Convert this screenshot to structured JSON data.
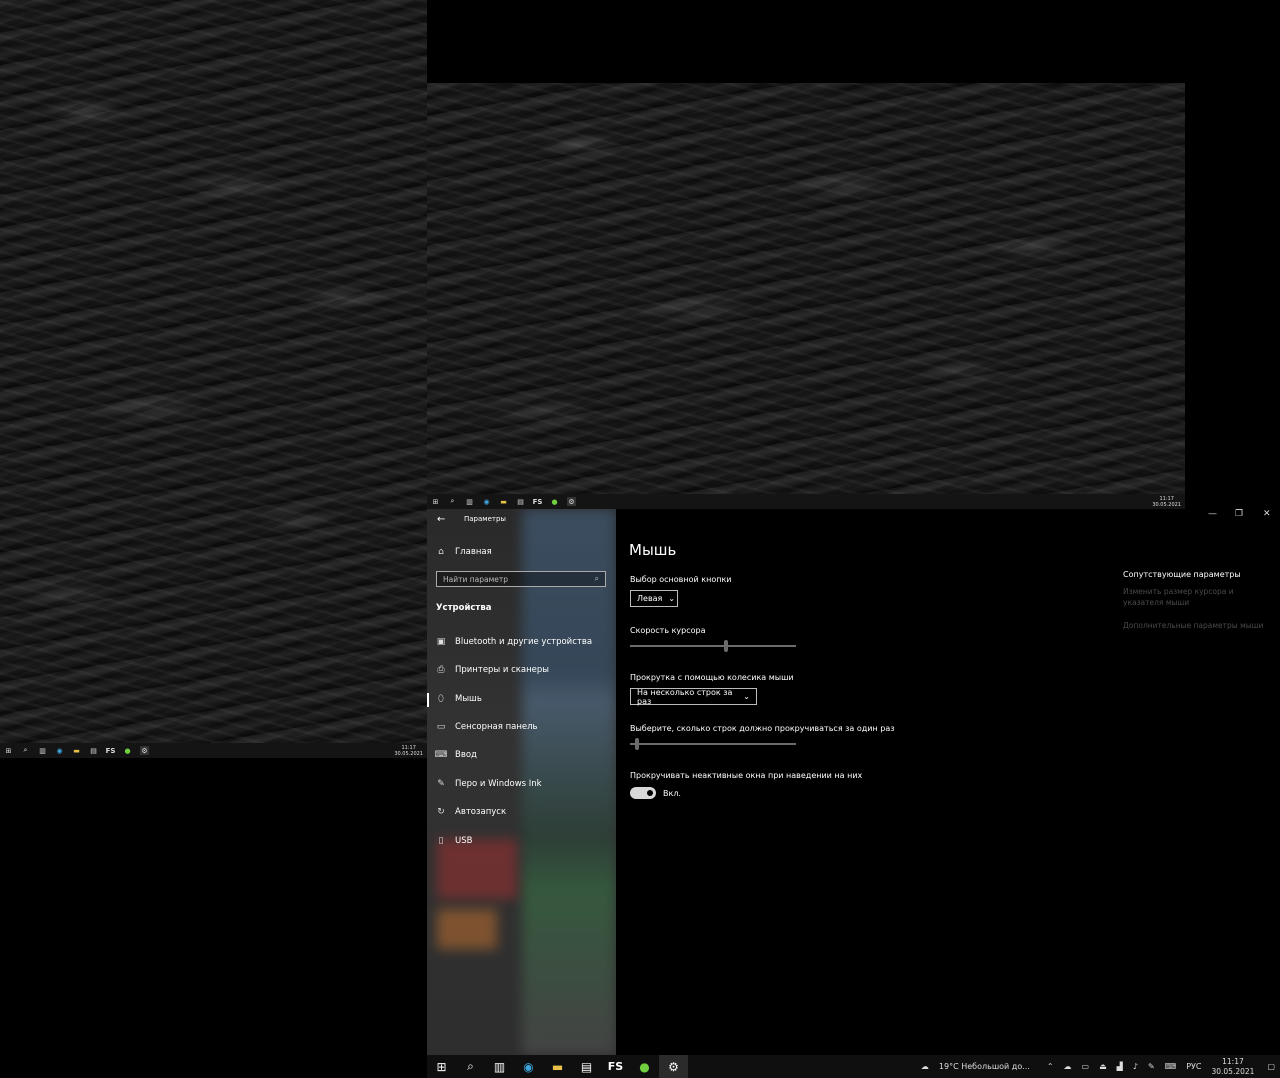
{
  "monitor_left": {
    "taskbar": {
      "time": "11:17",
      "date": "30.05.2021"
    }
  },
  "monitor_top": {
    "taskbar": {
      "time": "11:17",
      "date": "30.05.2021"
    }
  },
  "settings": {
    "window_title": "Параметры",
    "home_label": "Главная",
    "search_placeholder": "Найти параметр",
    "section_title": "Устройства",
    "nav_items": [
      {
        "label": "Bluetooth и другие устройства",
        "icon": "bluetooth-device-icon"
      },
      {
        "label": "Принтеры и сканеры",
        "icon": "printer-icon"
      },
      {
        "label": "Мышь",
        "icon": "mouse-icon"
      },
      {
        "label": "Сенсорная панель",
        "icon": "touchpad-icon"
      },
      {
        "label": "Ввод",
        "icon": "keyboard-icon"
      },
      {
        "label": "Перо и Windows Ink",
        "icon": "pen-icon"
      },
      {
        "label": "Автозапуск",
        "icon": "autoplay-icon"
      },
      {
        "label": "USB",
        "icon": "usb-icon"
      }
    ],
    "page_title": "Мышь",
    "primary_button_label": "Выбор основной кнопки",
    "primary_button_value": "Левая",
    "cursor_speed_label": "Скорость курсора",
    "cursor_speed_level": 0.58,
    "wheel_scroll_label": "Прокрутка с помощью колесика мыши",
    "wheel_scroll_value": "На несколько строк за раз",
    "lines_label": "Выберите, сколько строк должно прокручиваться за один раз",
    "lines_level": 0.03,
    "inactive_scroll_label": "Прокручивать неактивные окна при наведении на них",
    "inactive_scroll_state": "Вкл.",
    "related_title": "Сопутствующие параметры",
    "related_link1_line1": "Изменить размер курсора и",
    "related_link1_line2": "указателя мыши",
    "related_link2": "Дополнительные параметры мыши"
  },
  "taskbar": {
    "fs_label": "FS",
    "weather": "19°C  Небольшой до...",
    "lang": "РУС",
    "time": "11:17",
    "date": "30.05.2021"
  },
  "colors": {
    "accent_toggle": "#d8d8d8",
    "background": "#000000"
  }
}
